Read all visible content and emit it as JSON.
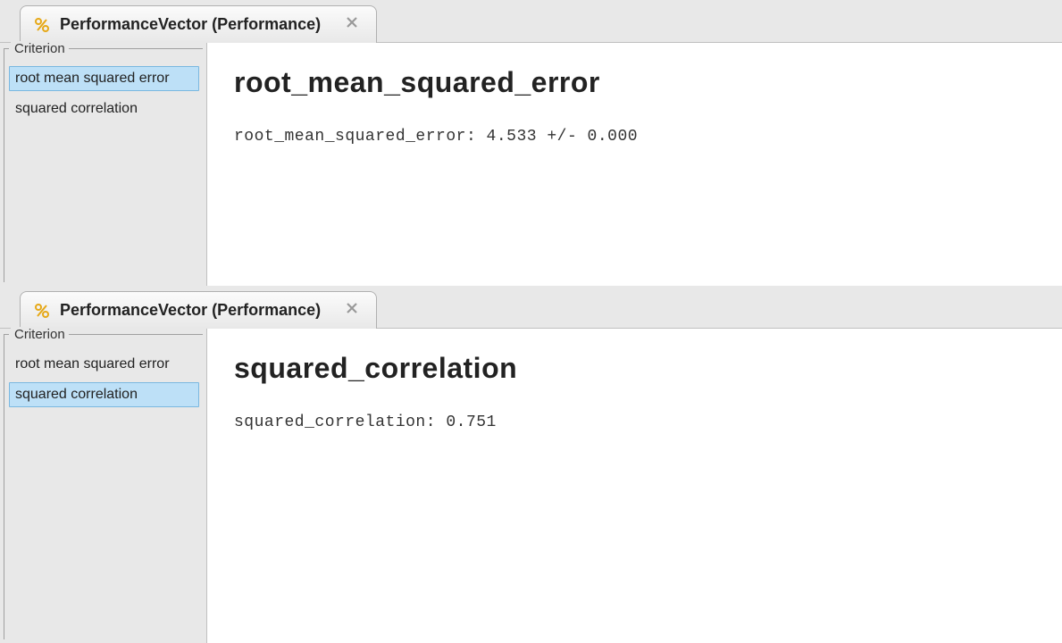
{
  "panels": [
    {
      "tab_title": "PerformanceVector (Performance)",
      "sidebar": {
        "label": "Criterion",
        "items": [
          {
            "label": "root mean squared error",
            "selected": true
          },
          {
            "label": "squared correlation",
            "selected": false
          }
        ]
      },
      "content": {
        "title": "root_mean_squared_error",
        "detail": "root_mean_squared_error: 4.533 +/- 0.000"
      }
    },
    {
      "tab_title": "PerformanceVector (Performance)",
      "sidebar": {
        "label": "Criterion",
        "items": [
          {
            "label": "root mean squared error",
            "selected": false
          },
          {
            "label": "squared correlation",
            "selected": true
          }
        ]
      },
      "content": {
        "title": "squared_correlation",
        "detail": "squared_correlation: 0.751"
      }
    }
  ]
}
